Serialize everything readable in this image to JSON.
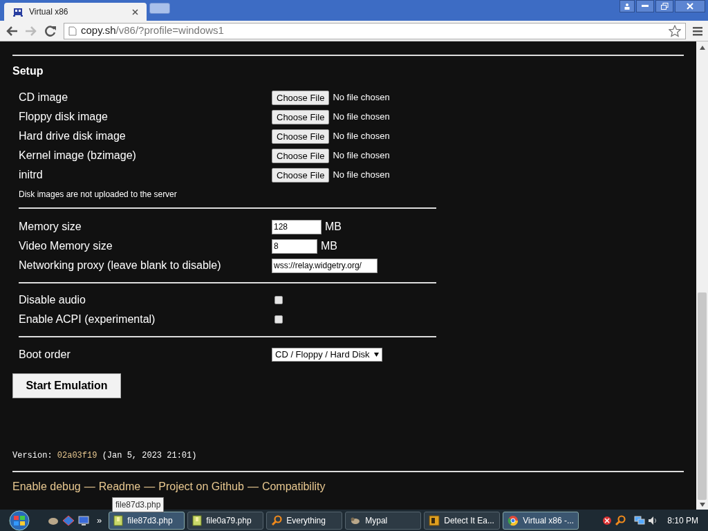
{
  "browser": {
    "tabs": [
      {
        "kind": "page",
        "title": "Virtual x86",
        "selected": true
      },
      {
        "kind": "new",
        "selected": false
      }
    ],
    "url": {
      "host": "copy.sh",
      "path": "/v86/?profile=windows1"
    }
  },
  "setup": {
    "title": "Setup",
    "files": [
      {
        "label": "CD image",
        "button": "Choose File",
        "status": "No file chosen"
      },
      {
        "label": "Floppy disk image",
        "button": "Choose File",
        "status": "No file chosen"
      },
      {
        "label": "Hard drive disk image",
        "button": "Choose File",
        "status": "No file chosen"
      },
      {
        "label": "Kernel image (bzimage)",
        "button": "Choose File",
        "status": "No file chosen"
      },
      {
        "label": "initrd",
        "button": "Choose File",
        "status": "No file chosen"
      }
    ],
    "note": "Disk images are not uploaded to the server",
    "fields": [
      {
        "label": "Memory size",
        "value": "128",
        "unit": "MB"
      },
      {
        "label": "Video Memory size",
        "value": "8",
        "unit": "MB"
      },
      {
        "label": "Networking proxy (leave blank to disable)",
        "value": "wss://relay.widgetry.org/"
      }
    ],
    "checkboxes": [
      {
        "label": "Disable audio",
        "checked": false
      },
      {
        "label": "Enable ACPI (experimental)",
        "checked": false
      }
    ],
    "boot_order": {
      "label": "Boot order",
      "value": "CD / Floppy / Hard Disk"
    },
    "start_button": "Start Emulation"
  },
  "version": {
    "label": "Version:",
    "hash": "02a03f19",
    "date": "(Jan 5, 2023 21:01)"
  },
  "links": {
    "separator": "—",
    "items": [
      "Enable debug",
      "Readme",
      "Project on Github",
      "Compatibility"
    ]
  },
  "taskbar": {
    "overflow": "»",
    "items": [
      {
        "label": "file87d3.php",
        "kind": "file",
        "selected": true
      },
      {
        "label": "file0a79.php",
        "kind": "file",
        "selected": false
      },
      {
        "label": "Everything",
        "kind": "search",
        "selected": false
      },
      {
        "label": "Mypal",
        "kind": "animal",
        "selected": false
      },
      {
        "label": "Detect It Ea...",
        "kind": "app",
        "selected": false
      },
      {
        "label": "Virtual x86 -...",
        "kind": "browser",
        "selected": true
      }
    ],
    "tooltip": "file87d3.php",
    "clock": "8:10 PM"
  }
}
